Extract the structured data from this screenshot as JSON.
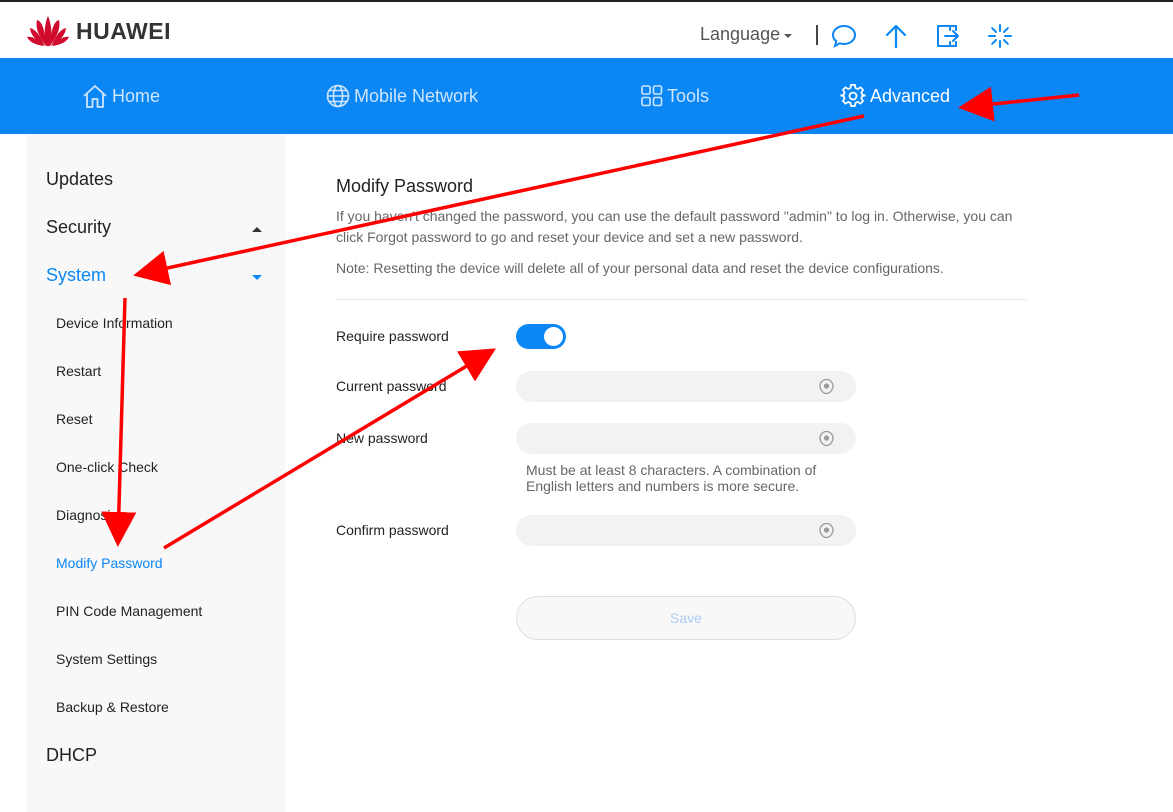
{
  "header": {
    "brand": "HUAWEI",
    "language_label": "Language",
    "icons": [
      "chat-icon",
      "upload-arrow-icon",
      "logout-icon",
      "loading-spinner-icon"
    ]
  },
  "nav": {
    "items": [
      {
        "label": "Home",
        "icon": "home-icon"
      },
      {
        "label": "Mobile Network",
        "icon": "globe-icon"
      },
      {
        "label": "Tools",
        "icon": "tools-grid-icon"
      },
      {
        "label": "Advanced",
        "icon": "gear-icon",
        "active": true
      }
    ]
  },
  "sidebar": {
    "groups": [
      {
        "label": "Updates"
      },
      {
        "label": "Security",
        "expanded": false
      },
      {
        "label": "System",
        "expanded": true,
        "active": true
      },
      {
        "label": "DHCP"
      }
    ],
    "system_items": [
      {
        "label": "Device Information"
      },
      {
        "label": "Restart"
      },
      {
        "label": "Reset"
      },
      {
        "label": "One-click Check"
      },
      {
        "label": "Diagnosis"
      },
      {
        "label": "Modify Password",
        "active": true
      },
      {
        "label": "PIN Code Management"
      },
      {
        "label": "System Settings"
      },
      {
        "label": "Backup & Restore"
      }
    ]
  },
  "main": {
    "title": "Modify Password",
    "description": "If you haven't changed the password, you can use the default password \"admin\" to log in. Otherwise, you can click Forgot password to go and reset your device and set a new password.",
    "note": "Note: Resetting the device will delete all of your personal data and reset the device configurations.",
    "require_password_label": "Require password",
    "require_password_on": true,
    "current_password_label": "Current password",
    "current_password_value": "",
    "new_password_label": "New password",
    "new_password_value": "",
    "new_password_hint": "Must be at least 8 characters. A combination of English letters and numbers is more secure.",
    "confirm_password_label": "Confirm password",
    "confirm_password_value": "",
    "save_label": "Save"
  },
  "colors": {
    "brand_blue": "#0a86f5",
    "annotation_red": "#ff0000",
    "huawei_red": "#cf0a2c"
  }
}
